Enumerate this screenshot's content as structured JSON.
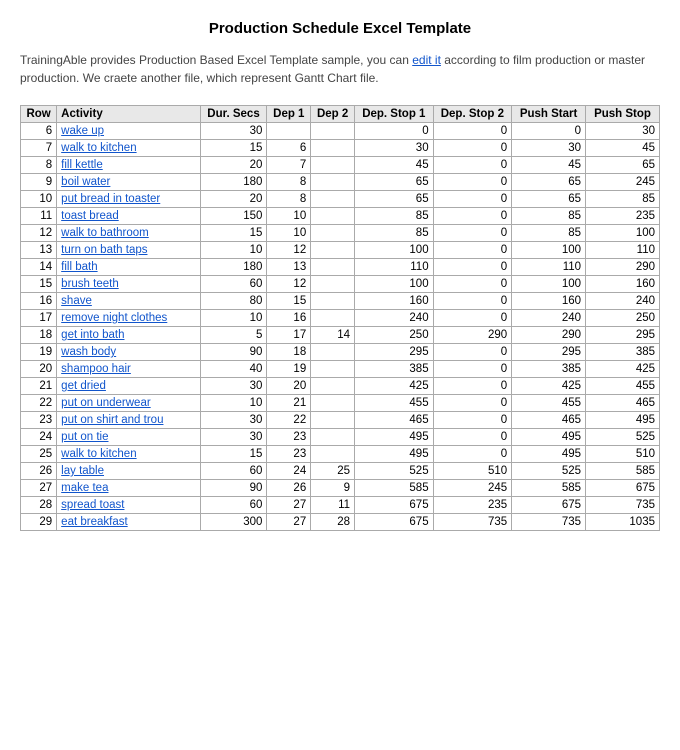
{
  "title": "Production Schedule Excel Template",
  "description": "TrainingAble provides Production Based Excel Template sample, you can edit it according to film production or master production. We craete another file, which represent Gantt Chart file.",
  "table": {
    "headers": [
      "Row",
      "Activity",
      "Dur. Secs",
      "Dep 1",
      "Dep 2",
      "Dep. Stop 1",
      "Dep. Stop 2",
      "Push Start",
      "Push Stop"
    ],
    "rows": [
      [
        6,
        "wake up",
        30,
        "",
        "",
        0,
        0,
        0,
        30
      ],
      [
        7,
        "walk to kitchen",
        15,
        6,
        "",
        30,
        0,
        30,
        45
      ],
      [
        8,
        "fill kettle",
        20,
        7,
        "",
        45,
        0,
        45,
        65
      ],
      [
        9,
        "boil water",
        180,
        8,
        "",
        65,
        0,
        65,
        245
      ],
      [
        10,
        "put bread in toaster",
        20,
        8,
        "",
        65,
        0,
        65,
        85
      ],
      [
        11,
        "toast bread",
        150,
        10,
        "",
        85,
        0,
        85,
        235
      ],
      [
        12,
        "walk to bathroom",
        15,
        10,
        "",
        85,
        0,
        85,
        100
      ],
      [
        13,
        "turn on bath taps",
        10,
        12,
        "",
        100,
        0,
        100,
        110
      ],
      [
        14,
        "fill bath",
        180,
        13,
        "",
        110,
        0,
        110,
        290
      ],
      [
        15,
        "brush teeth",
        60,
        12,
        "",
        100,
        0,
        100,
        160
      ],
      [
        16,
        "shave",
        80,
        15,
        "",
        160,
        0,
        160,
        240
      ],
      [
        17,
        "remove night clothes",
        10,
        16,
        "",
        240,
        0,
        240,
        250
      ],
      [
        18,
        "get into bath",
        5,
        17,
        14,
        250,
        290,
        290,
        295
      ],
      [
        19,
        "wash body",
        90,
        18,
        "",
        295,
        0,
        295,
        385
      ],
      [
        20,
        "shampoo hair",
        40,
        19,
        "",
        385,
        0,
        385,
        425
      ],
      [
        21,
        "get dried",
        30,
        20,
        "",
        425,
        0,
        425,
        455
      ],
      [
        22,
        "put on underwear",
        10,
        21,
        "",
        455,
        0,
        455,
        465
      ],
      [
        23,
        "put on shirt and trou",
        30,
        22,
        "",
        465,
        0,
        465,
        495
      ],
      [
        24,
        "put on tie",
        30,
        23,
        "",
        495,
        0,
        495,
        525
      ],
      [
        25,
        "walk to kitchen",
        15,
        23,
        "",
        495,
        0,
        495,
        510
      ],
      [
        26,
        "lay table",
        60,
        24,
        25,
        525,
        510,
        525,
        585
      ],
      [
        27,
        "make tea",
        90,
        26,
        9,
        585,
        245,
        585,
        675
      ],
      [
        28,
        "spread toast",
        60,
        27,
        11,
        675,
        235,
        675,
        735
      ],
      [
        29,
        "eat breakfast",
        300,
        27,
        28,
        675,
        735,
        735,
        1035
      ]
    ]
  }
}
